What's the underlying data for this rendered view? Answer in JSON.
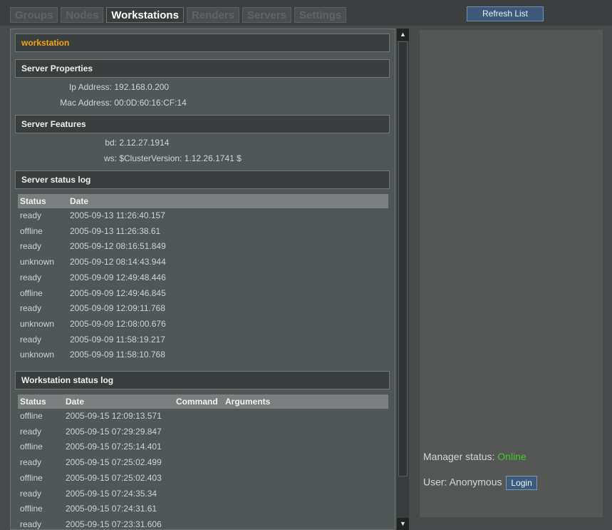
{
  "tabs": [
    {
      "label": "Groups",
      "active": false
    },
    {
      "label": "Nodes",
      "active": false
    },
    {
      "label": "Workstations",
      "active": true
    },
    {
      "label": "Renders",
      "active": false
    },
    {
      "label": "Servers",
      "active": false
    },
    {
      "label": "Settings",
      "active": false
    }
  ],
  "toolbar": {
    "refresh_label": "Refresh List"
  },
  "workstation": {
    "title": "workstation"
  },
  "server_properties": {
    "header": "Server Properties",
    "ip_label": "Ip Address:",
    "ip_value": "192.168.0.200",
    "mac_label": "Mac Address:",
    "mac_value": "00:0D:60:16:CF:14"
  },
  "server_features": {
    "header": "Server Features",
    "bd_label": "bd:",
    "bd_value": "2.12.27.1914",
    "ws_label": "ws:",
    "ws_value": "$ClusterVersion: 1.12.26.1741 $"
  },
  "server_log": {
    "header": "Server status log",
    "columns": [
      "Status",
      "Date"
    ],
    "rows": [
      [
        "ready",
        "2005-09-13 11:26:40.157"
      ],
      [
        "offline",
        "2005-09-13 11:26:38.61"
      ],
      [
        "ready",
        "2005-09-12 08:16:51.849"
      ],
      [
        "unknown",
        "2005-09-12 08:14:43.944"
      ],
      [
        "ready",
        "2005-09-09 12:49:48.446"
      ],
      [
        "offline",
        "2005-09-09 12:49:46.845"
      ],
      [
        "ready",
        "2005-09-09 12:09:11.768"
      ],
      [
        "unknown",
        "2005-09-09 12:08:00.676"
      ],
      [
        "ready",
        "2005-09-09 11:58:19.217"
      ],
      [
        "unknown",
        "2005-09-09 11:58:10.768"
      ]
    ]
  },
  "workstation_log": {
    "header": "Workstation status log",
    "columns": [
      "Status",
      "Date",
      "Command",
      "Arguments"
    ],
    "rows": [
      [
        "offline",
        "2005-09-15 12:09:13.571"
      ],
      [
        "ready",
        "2005-09-15 07:29:29.847"
      ],
      [
        "offline",
        "2005-09-15 07:25:14.401"
      ],
      [
        "ready",
        "2005-09-15 07:25:02.499"
      ],
      [
        "offline",
        "2005-09-15 07:25:02.403"
      ],
      [
        "ready",
        "2005-09-15 07:24:35.34"
      ],
      [
        "offline",
        "2005-09-15 07:24:31.61"
      ],
      [
        "ready",
        "2005-09-15 07:23:31.606"
      ]
    ]
  },
  "manager": {
    "status_label": "Manager status:",
    "status_value": "Online",
    "status_color": "#3dcb23",
    "user_label": "User: Anonymous",
    "login_label": "Login"
  },
  "scrollbar": {
    "up_icon": "arrow-up-icon",
    "down_icon": "arrow-down-icon"
  }
}
